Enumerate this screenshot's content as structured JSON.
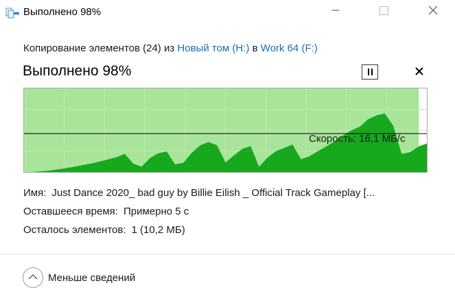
{
  "window": {
    "title": "Выполнено 98%"
  },
  "copy": {
    "prefix": "Копирование элементов (24) из",
    "source": "Новый том (H:)",
    "middle": "в",
    "destination": "Work 64 (F:)"
  },
  "progress": {
    "heading": "Выполнено 98%",
    "percent": 98,
    "speed_label": "Скорость: 16,1 МБ/с"
  },
  "chart_data": {
    "type": "area",
    "title": "",
    "xlabel": "",
    "ylabel": "",
    "progress_fill": 0.98,
    "current_speed": "16,1 МБ/с",
    "series": [
      {
        "values": [
          0,
          0,
          0.3,
          0.6,
          1.1,
          1.6,
          2.2,
          2.9,
          3.6,
          4.4,
          5.3,
          6.2,
          7.6,
          3.6,
          2.2,
          5.8,
          7.9,
          8.6,
          3.2,
          3.9,
          8.1,
          11.2,
          12.6,
          11.2,
          4.0,
          6.9,
          9.7,
          10.9,
          2.2,
          6.0,
          8.7,
          10.1,
          11.5,
          5.3,
          6.6,
          8.7,
          10.7,
          12.9,
          15.3,
          17.4,
          19.0,
          22.1,
          23.7,
          24.5,
          19.3,
          7.6,
          8.3,
          10.7,
          12.0
        ],
        "color": "#17a81d"
      }
    ],
    "colors": {
      "background_fill": "#a8e59a",
      "chart_grid": "#c0e6b0",
      "area": "#17a81d",
      "speed_line": "#000000"
    }
  },
  "details": {
    "name_label": "Имя:",
    "name_value": "Just Dance 2020_ bad guy by Billie Eilish _ Official Track Gameplay [...",
    "time_label": "Оставшееся время:",
    "time_value": "Примерно 5 с",
    "items_label": "Осталось элементов:",
    "items_value": "1 (10,2 МБ)"
  },
  "footer": {
    "less_details_label": "Меньше сведений",
    "toggle_icon": "chevron-up-icon"
  },
  "icons": {
    "app": "file-copy-icon",
    "minimize": "minimize-icon",
    "maximize": "maximize-icon",
    "close": "close-icon",
    "pause": "pause-icon",
    "cancel": "close-icon"
  }
}
